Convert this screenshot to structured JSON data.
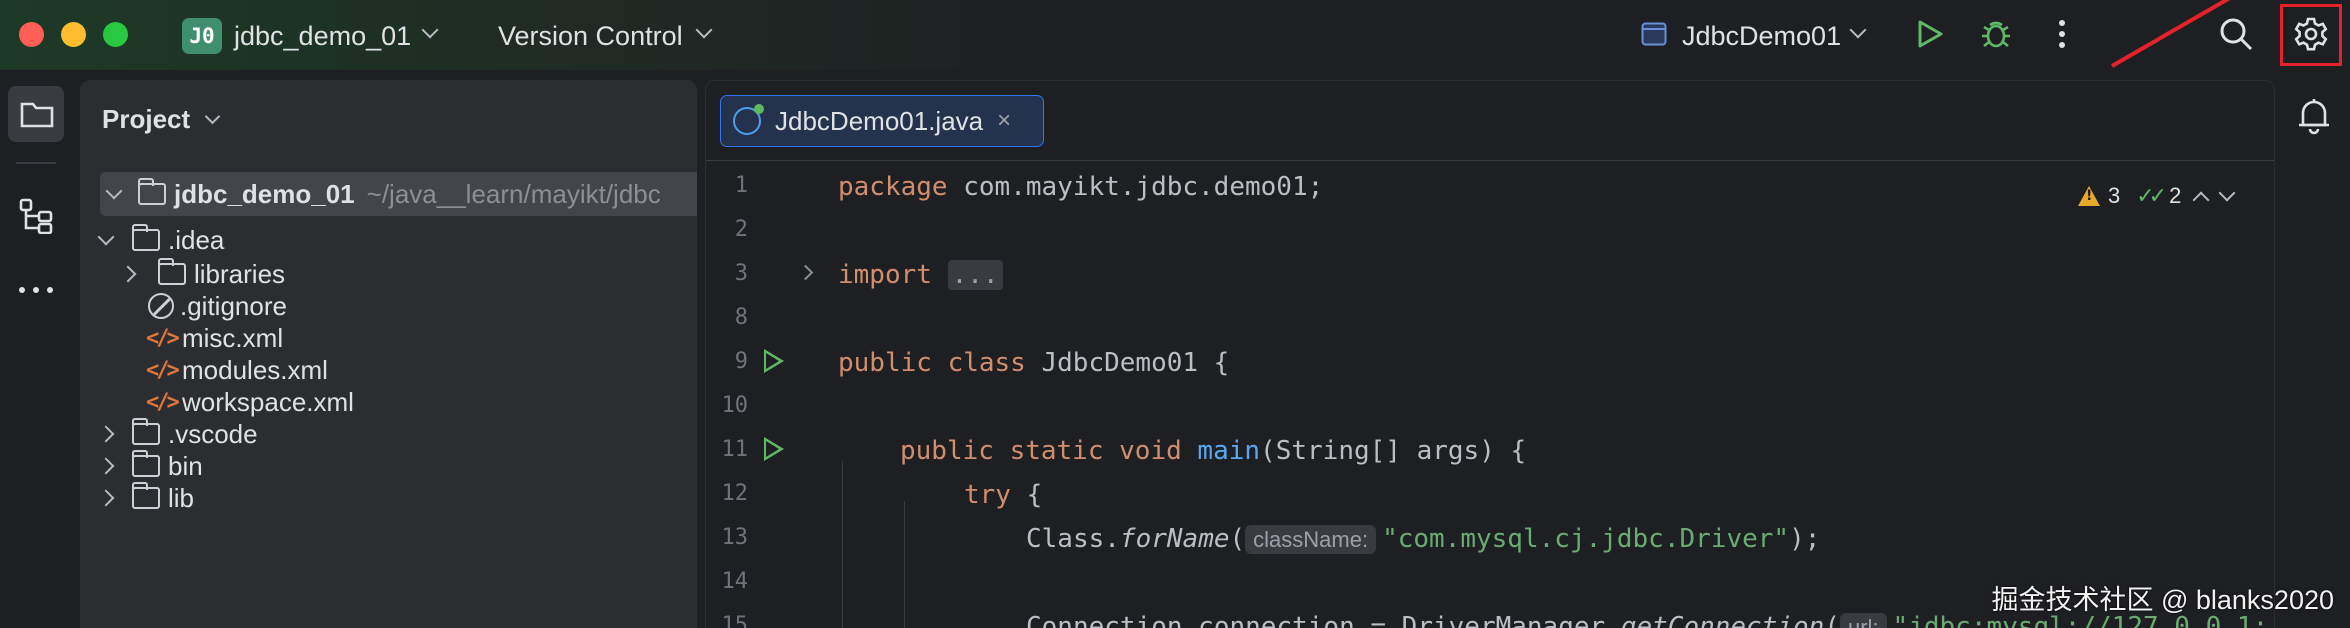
{
  "titlebar": {
    "project_badge": "J0",
    "project_name": "jdbc_demo_01",
    "vcs_label": "Version Control",
    "run_config": "JdbcDemo01"
  },
  "project_panel": {
    "title": "Project",
    "tree": [
      {
        "label": "jdbc_demo_01",
        "hint": "~/java__learn/mayikt/jdbc",
        "type": "module",
        "expanded": true
      },
      {
        "label": ".idea",
        "type": "folder",
        "expanded": true
      },
      {
        "label": "libraries",
        "type": "folder",
        "expanded": false
      },
      {
        "label": ".gitignore",
        "type": "ignore"
      },
      {
        "label": "misc.xml",
        "type": "xml"
      },
      {
        "label": "modules.xml",
        "type": "xml"
      },
      {
        "label": "workspace.xml",
        "type": "xml"
      },
      {
        "label": ".vscode",
        "type": "folder",
        "expanded": false
      },
      {
        "label": "bin",
        "type": "folder",
        "expanded": false
      },
      {
        "label": "lib",
        "type": "folder",
        "expanded": false
      }
    ]
  },
  "editor": {
    "tab_label": "JdbcDemo01.java",
    "tab_close": "×",
    "inspections": {
      "warnings": "3",
      "ok": "2"
    },
    "line_numbers": [
      "1",
      "2",
      "3",
      "8",
      "9",
      "10",
      "11",
      "12",
      "13",
      "14",
      "15"
    ],
    "code": {
      "l1_kw": "package",
      "l1_rest": " com.mayikt.jdbc.demo01;",
      "l3_kw": "import",
      "l3_fold": "...",
      "l9_kw": "public class",
      "l9_rest": " JdbcDemo01 {",
      "l11_kw": "public static void",
      "l11_fn": "main",
      "l11_rest": "(String[] args) {",
      "l12_kw": "try",
      "l12_rest": " {",
      "l13_pre": "Class.",
      "l13_it": "forName",
      "l13_paren": "(",
      "l13_hint": "className:",
      "l13_str": "\"com.mysql.cj.jdbc.Driver\"",
      "l13_end": ");",
      "l15_pre": "Connection connection = DriverManager.",
      "l15_it": "getConnection",
      "l15_paren": "(",
      "l15_hint": "url:",
      "l15_str": "\"jdbc:mysql://127.0.0.1:"
    }
  },
  "watermark": "掘金技术社区 @ blanks2020",
  "colors": {
    "highlight": "#e5222b",
    "accent": "#3574f0",
    "run": "#5fb865"
  }
}
